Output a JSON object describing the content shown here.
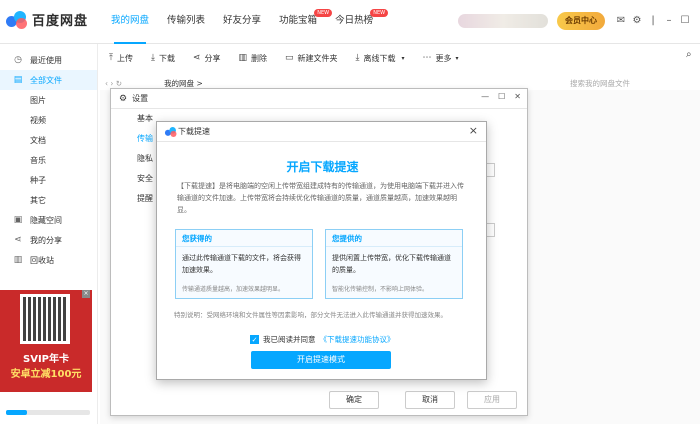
{
  "app": {
    "title": "百度网盘"
  },
  "nav": {
    "items": [
      {
        "label": "我的网盘",
        "active": true,
        "badge": ""
      },
      {
        "label": "传输列表",
        "active": false,
        "badge": ""
      },
      {
        "label": "好友分享",
        "active": false,
        "badge": ""
      },
      {
        "label": "功能宝箱",
        "active": false,
        "badge": "NEW"
      },
      {
        "label": "今日热榜",
        "active": false,
        "badge": "NEW"
      }
    ]
  },
  "header": {
    "vip_label": "会员中心"
  },
  "sidebar": {
    "items": [
      {
        "label": "最近使用",
        "icon": "clock-icon",
        "glyph": "◷",
        "level": "top",
        "active": false
      },
      {
        "label": "全部文件",
        "icon": "file-icon",
        "glyph": "▤",
        "level": "top",
        "active": true
      },
      {
        "label": "图片",
        "level": "sub",
        "active": false
      },
      {
        "label": "视频",
        "level": "sub",
        "active": false
      },
      {
        "label": "文档",
        "level": "sub",
        "active": false
      },
      {
        "label": "音乐",
        "level": "sub",
        "active": false
      },
      {
        "label": "种子",
        "level": "sub",
        "active": false
      },
      {
        "label": "其它",
        "level": "sub",
        "active": false
      },
      {
        "label": "隐藏空间",
        "icon": "lock-icon",
        "glyph": "▣",
        "level": "top",
        "active": false
      },
      {
        "label": "我的分享",
        "icon": "share-icon",
        "glyph": "⋖",
        "level": "top",
        "active": false
      },
      {
        "label": "回收站",
        "icon": "trash-icon",
        "glyph": "▥",
        "level": "top",
        "active": false
      }
    ],
    "ad": {
      "line1": "SVIP年卡",
      "line2": "安卓立减100元"
    },
    "storage": {
      "used_fraction": 0.25
    }
  },
  "toolbar": {
    "items": [
      {
        "label": "上传",
        "icon": "upload-icon",
        "glyph": "⤒"
      },
      {
        "label": "下载",
        "icon": "download-icon",
        "glyph": "⤓"
      },
      {
        "label": "分享",
        "icon": "share-icon",
        "glyph": "⋖"
      },
      {
        "label": "删除",
        "icon": "trash-icon",
        "glyph": "▥"
      },
      {
        "label": "新建文件夹",
        "icon": "folder-add-icon",
        "glyph": "▭"
      },
      {
        "label": "离线下载",
        "icon": "offline-download-icon",
        "glyph": "⤓"
      },
      {
        "label": "更多",
        "icon": "more-icon",
        "glyph": "⋯"
      }
    ]
  },
  "breadcrumb": {
    "text": "我的网盘 >"
  },
  "search": {
    "placeholder": "搜索我的网盘文件"
  },
  "settings": {
    "title": "设置",
    "nav": [
      {
        "label": "基本",
        "active": false
      },
      {
        "label": "传输",
        "active": true
      },
      {
        "label": "隐私",
        "active": false
      },
      {
        "label": "安全",
        "active": false
      },
      {
        "label": "提醒",
        "active": false
      }
    ],
    "ok_label": "确定",
    "cancel_label": "取消",
    "apply_label": "应用"
  },
  "dialog": {
    "title": "下载提速",
    "heading": "开启下载提速",
    "description": "【下载提速】是将电脑端的空闲上传带宽组建成特有的传输通道，为使用电脑端下载并进入传输通道的文件加速。上传带宽将会持续优化传输通道的质量，通道质量越高，加速效果越明显。",
    "card_get": {
      "title": "您获得的",
      "text": "通过此传输通道下载的文件，将会获得加速效果。",
      "note": "传输通道质量越高，加速效果越明显。"
    },
    "card_give": {
      "title": "您提供的",
      "text": "提供闲置上传带宽，优化下载传输通道的质量。",
      "note": "智能化传输控制，不影响上网体验。"
    },
    "tip": "特别说明：受网络环境和文件属性等因素影响，部分文件无法进入此传输通道并获得加速效果。",
    "agree_label": "我已阅读并同意",
    "agree_link": "《下载提速功能协议》",
    "primary_label": "开启提速模式"
  }
}
